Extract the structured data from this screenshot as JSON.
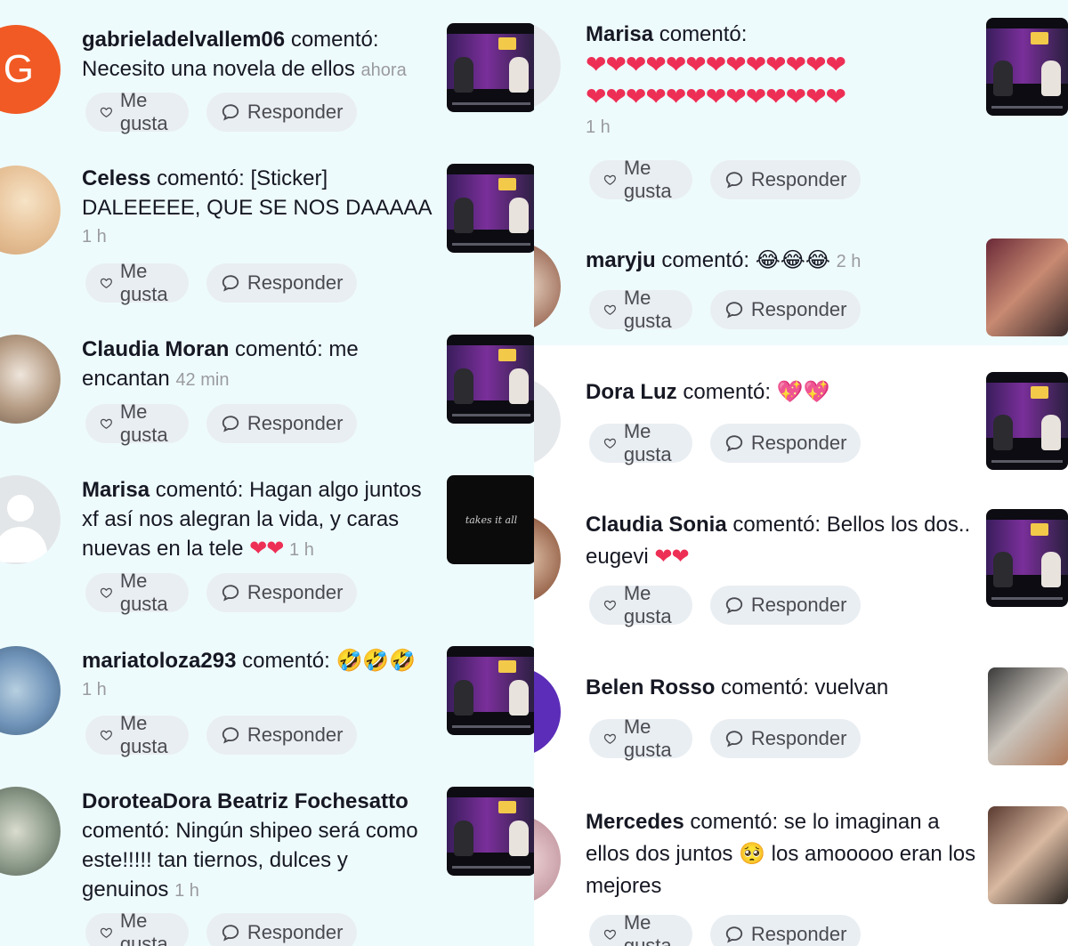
{
  "actions": {
    "like_label": "Me gusta",
    "reply_label": "Responder"
  },
  "colors": {
    "panel_bg": "#eefbfd",
    "pill_bg": "#e9eef2",
    "heart": "#ee2f55",
    "avatar_orange": "#f15a24"
  },
  "left_comments": [
    {
      "user": "gabrieladelvallem06",
      "verb": "comentó:",
      "text": "Necesito una novela de ellos",
      "time": "ahora",
      "avatar_letter": "G"
    },
    {
      "user": "Celess",
      "verb": "comentó:",
      "text": "[Sticker] DALEEEEE, QUE SE NOS DAAAAA",
      "time": "1 h"
    },
    {
      "user": "Claudia Moran",
      "verb": "comentó:",
      "text": "me encantan",
      "time": "42 min"
    },
    {
      "user": "Marisa",
      "verb": "comentó:",
      "text": "Hagan algo juntos xf así nos alegran la vida, y caras nuevas en la tele",
      "emoji": "❤❤",
      "time": "1 h",
      "thumb_text": "takes it all"
    },
    {
      "user": "mariatoloza293",
      "verb": "comentó:",
      "text": "🤣🤣🤣",
      "time": "1 h"
    },
    {
      "user": "DoroteaDora Beatriz Fochesatto",
      "verb": "comentó:",
      "text": "Ningún shipeo será como este!!!!! tan tiernos, dulces y genuinos",
      "time": "1 h"
    }
  ],
  "right_comments": [
    {
      "user": "Marisa",
      "verb": "comentó:",
      "hearts_row1": "❤❤❤❤❤❤❤❤❤❤❤❤❤",
      "hearts_row2": "❤❤❤❤❤❤❤❤❤❤❤❤❤",
      "time": "1 h"
    },
    {
      "user": "maryju",
      "verb": "comentó:",
      "text": "😂😂😂",
      "time": "2 h"
    },
    {
      "user": "Dora Luz",
      "verb": "comentó:",
      "text": "💖💖"
    },
    {
      "user": "Claudia Sonia",
      "verb": "comentó:",
      "text": "Bellos los dos.. eugevi",
      "emoji": "❤❤"
    },
    {
      "user": "Belen Rosso",
      "verb": "comentó:",
      "text": "vuelvan"
    },
    {
      "user": "Mercedes",
      "verb": "comentó:",
      "text": "se lo imaginan a ellos dos juntos 🥺 los amooooo eran los mejores"
    }
  ]
}
